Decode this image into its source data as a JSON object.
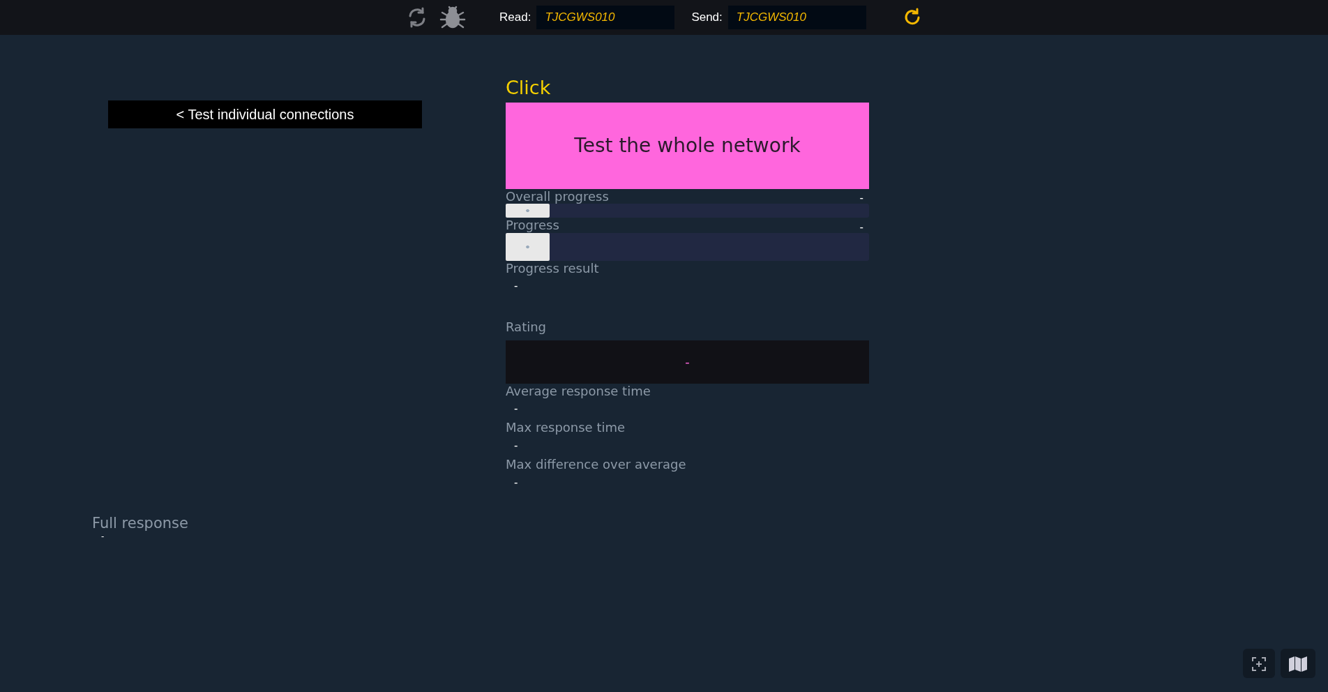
{
  "topbar": {
    "read": {
      "label": "Read:",
      "value": "TJCGWS010"
    },
    "send": {
      "label": "Send:",
      "value": "TJCGWS010"
    }
  },
  "back_button": "< Test individual connections",
  "test": {
    "title": "Click",
    "button": "Test the whole network",
    "overall_progress": {
      "label": "Overall progress",
      "reading": "-",
      "level": 0.12
    },
    "progress": {
      "label": "Progress",
      "reading": "-",
      "level": 0.12
    },
    "progress_result": {
      "label": "Progress result",
      "value": "-"
    },
    "rating": {
      "label": "Rating",
      "value": "-"
    },
    "stats": [
      {
        "label": "Average response time",
        "value": "-"
      },
      {
        "label": "Max response time",
        "value": "-"
      },
      {
        "label": "Max difference over average",
        "value": "-"
      }
    ]
  },
  "full_response": {
    "label": "Full response",
    "value": "-"
  }
}
